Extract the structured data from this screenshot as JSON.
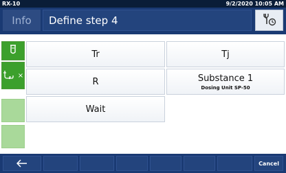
{
  "status_bar": {
    "device": "RX-10",
    "datetime": "9/2/2020 10:05 AM"
  },
  "header": {
    "info_label": "Info",
    "title": "Define step 4",
    "tool_icon": "wrench-clock-icon"
  },
  "sidebar": {
    "items": [
      {
        "icon": "reactor-vessel-icon",
        "state": "active"
      },
      {
        "icon": "dosing-funnel-icon",
        "close": "×",
        "state": "active"
      },
      {
        "icon": "",
        "state": "empty"
      },
      {
        "icon": "",
        "state": "empty"
      }
    ]
  },
  "tiles": {
    "tr": "Tr",
    "tj": "Tj",
    "r": "R",
    "substance": {
      "title": "Substance 1",
      "subtitle": "Dosing Unit SP-50"
    },
    "wait": "Wait"
  },
  "footer": {
    "back_icon": "arrow-left-icon",
    "cancel_label": "Cancel"
  },
  "colors": {
    "header_bg": "#1a3a73",
    "status_bg": "#0a1d38",
    "sidebar_active": "#3ca02c",
    "sidebar_idle": "#a9d99a"
  }
}
